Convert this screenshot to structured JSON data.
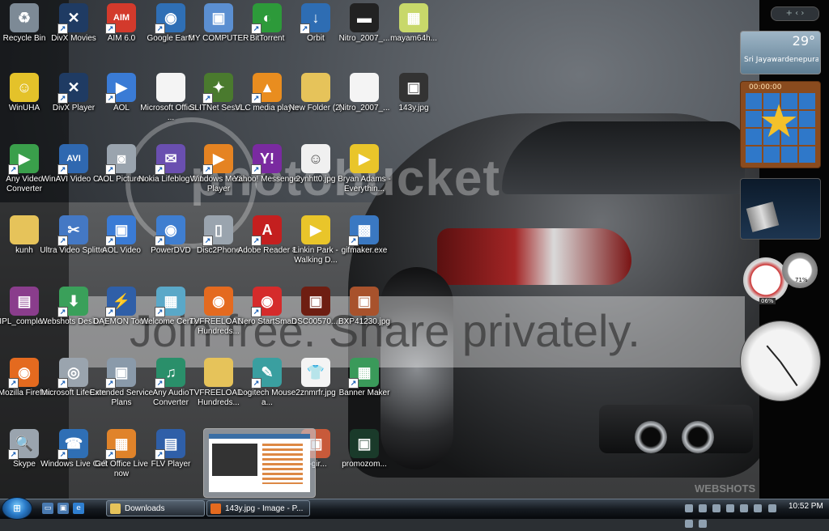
{
  "desktop": {
    "icons": [
      {
        "label": "Recycle Bin",
        "icon": "recycle-bin-icon",
        "color": "#7d8a96",
        "glyph": "♻",
        "shortcut": false
      },
      {
        "label": "DivX Movies",
        "icon": "divx-icon",
        "color": "#1f3b63",
        "glyph": "✕",
        "shortcut": true
      },
      {
        "label": "AIM 6.0",
        "icon": "aim-icon",
        "color": "#d33a2c",
        "glyph": "AIM",
        "shortcut": true
      },
      {
        "label": "Google Earth",
        "icon": "google-earth-icon",
        "color": "#2f6fb5",
        "glyph": "◉",
        "shortcut": true
      },
      {
        "label": "MY COMPUTER",
        "icon": "computer-icon",
        "color": "#5b8fd1",
        "glyph": "▣",
        "shortcut": false
      },
      {
        "label": "BitTorrent",
        "icon": "bittorrent-icon",
        "color": "#2d9a3a",
        "glyph": "◐",
        "shortcut": true
      },
      {
        "label": "Orbit",
        "icon": "orbit-icon",
        "color": "#2e6db3",
        "glyph": "↓",
        "shortcut": true
      },
      {
        "label": "Nitro_2007_...",
        "icon": "file-icon",
        "color": "#222",
        "glyph": "▬",
        "shortcut": false
      },
      {
        "label": "mayam64h...",
        "icon": "image-file-icon",
        "color": "#c8d86a",
        "glyph": "▦",
        "shortcut": false
      },
      {
        "label": "WinUHA",
        "icon": "winuha-icon",
        "color": "#e4c22a",
        "glyph": "☺",
        "shortcut": false
      },
      {
        "label": "DivX Player",
        "icon": "divx-player-icon",
        "color": "#1f3b63",
        "glyph": "✕",
        "shortcut": true
      },
      {
        "label": "AOL",
        "icon": "aol-icon",
        "color": "#3a7bd5",
        "glyph": "▶",
        "shortcut": true
      },
      {
        "label": "Microsoft Office - ...",
        "icon": "document-icon",
        "color": "#f4f4f4",
        "glyph": "",
        "shortcut": false
      },
      {
        "label": "SLITNet Sessi...",
        "icon": "slitnet-icon",
        "color": "#4a7a2e",
        "glyph": "✦",
        "shortcut": true
      },
      {
        "label": "VLC media player",
        "icon": "vlc-icon",
        "color": "#e98d1f",
        "glyph": "▲",
        "shortcut": true
      },
      {
        "label": "New Folder (2)",
        "icon": "folder-icon",
        "color": "#e6c35a",
        "glyph": "",
        "shortcut": false
      },
      {
        "label": "Nitro_2007_...",
        "icon": "document-icon",
        "color": "#f4f4f4",
        "glyph": "",
        "shortcut": false
      },
      {
        "label": "143y.jpg",
        "icon": "image-file-icon",
        "color": "#333",
        "glyph": "▣",
        "shortcut": false
      },
      {
        "label": "Any Video Converter",
        "icon": "video-converter-icon",
        "color": "#3a9f4b",
        "glyph": "▶",
        "shortcut": true
      },
      {
        "label": "WinAVI Video C...",
        "icon": "winavi-icon",
        "color": "#2f68b0",
        "glyph": "AVI",
        "shortcut": true
      },
      {
        "label": "AOL Pictures",
        "icon": "camera-icon",
        "color": "#9aa4ae",
        "glyph": "◙",
        "shortcut": true
      },
      {
        "label": "Nokia Lifeblog 2.1",
        "icon": "nokia-icon",
        "color": "#6a4fb0",
        "glyph": "✉",
        "shortcut": true
      },
      {
        "label": "Windows Media Player",
        "icon": "media-player-icon",
        "color": "#e58322",
        "glyph": "▶",
        "shortcut": true
      },
      {
        "label": "Yahoo! Messenger",
        "icon": "yahoo-icon",
        "color": "#7a2aa0",
        "glyph": "Y!",
        "shortcut": true
      },
      {
        "label": "2ynhtt0.jpg",
        "icon": "image-file-icon",
        "color": "#f0f0f0",
        "glyph": "☺",
        "shortcut": false
      },
      {
        "label": "Bryan Adams - Everythin...",
        "icon": "media-file-icon",
        "color": "#e9c52a",
        "glyph": "▶",
        "shortcut": false
      },
      {
        "label": "",
        "icon": "",
        "color": "",
        "glyph": "",
        "shortcut": false
      },
      {
        "label": "kunh",
        "icon": "folder-icon",
        "color": "#e6c35a",
        "glyph": "",
        "shortcut": false
      },
      {
        "label": "Ultra Video Splitter",
        "icon": "video-splitter-icon",
        "color": "#4478c4",
        "glyph": "✂",
        "shortcut": true
      },
      {
        "label": "AOL Video",
        "icon": "aol-video-icon",
        "color": "#3a7bd5",
        "glyph": "▣",
        "shortcut": true
      },
      {
        "label": "PowerDVD",
        "icon": "powerdvd-icon",
        "color": "#3f7ed0",
        "glyph": "◉",
        "shortcut": true
      },
      {
        "label": "Disc2Phone",
        "icon": "disc2phone-icon",
        "color": "#9aa4ae",
        "glyph": "▯",
        "shortcut": true
      },
      {
        "label": "Adobe Reader 8",
        "icon": "adobe-reader-icon",
        "color": "#c41f1f",
        "glyph": "A",
        "shortcut": true
      },
      {
        "label": "Linkin Park - Walking D...",
        "icon": "media-file-icon",
        "color": "#e9c52a",
        "glyph": "▶",
        "shortcut": false
      },
      {
        "label": "gifmaker.exe",
        "icon": "gifmaker-icon",
        "color": "#3a78c2",
        "glyph": "▩",
        "shortcut": true
      },
      {
        "label": "",
        "icon": "",
        "color": "",
        "glyph": "",
        "shortcut": false
      },
      {
        "label": "IPL_comple...",
        "icon": "archive-icon",
        "color": "#8a3d8c",
        "glyph": "▤",
        "shortcut": false
      },
      {
        "label": "Webshots Desktop",
        "icon": "webshots-icon",
        "color": "#3aa05a",
        "glyph": "⬇",
        "shortcut": true
      },
      {
        "label": "DAEMON Tools",
        "icon": "daemon-tools-icon",
        "color": "#2f5fa8",
        "glyph": "⚡",
        "shortcut": true
      },
      {
        "label": "Welcome Center",
        "icon": "welcome-center-icon",
        "color": "#5aa8c8",
        "glyph": "▦",
        "shortcut": true
      },
      {
        "label": "TVFREELOAD - Hundreds...",
        "icon": "firefox-doc-icon",
        "color": "#e46a1f",
        "glyph": "◉",
        "shortcut": false
      },
      {
        "label": "Nero StartSmart",
        "icon": "nero-icon",
        "color": "#d52b2b",
        "glyph": "◉",
        "shortcut": true
      },
      {
        "label": "DSC00570....",
        "icon": "image-file-icon",
        "color": "#6e1e12",
        "glyph": "▣",
        "shortcut": false
      },
      {
        "label": "BXP41230.jpg",
        "icon": "image-file-icon",
        "color": "#a8522c",
        "glyph": "▣",
        "shortcut": false
      },
      {
        "label": "",
        "icon": "",
        "color": "",
        "glyph": "",
        "shortcut": false
      },
      {
        "label": "Mozilla Firefox",
        "icon": "firefox-icon",
        "color": "#e46a1f",
        "glyph": "◉",
        "shortcut": true
      },
      {
        "label": "Microsoft LifeCam",
        "icon": "webcam-icon",
        "color": "#9aa4ae",
        "glyph": "◎",
        "shortcut": true
      },
      {
        "label": "Extended Service Plans",
        "icon": "service-plans-icon",
        "color": "#8a9aaa",
        "glyph": "▣",
        "shortcut": true
      },
      {
        "label": "Any Audio Converter",
        "icon": "audio-converter-icon",
        "color": "#2a8f6a",
        "glyph": "♫",
        "shortcut": true
      },
      {
        "label": "TVFREELOAD - Hundreds...",
        "icon": "folder-icon",
        "color": "#e6c35a",
        "glyph": "",
        "shortcut": false
      },
      {
        "label": "Logitech Mouse a...",
        "icon": "logitech-icon",
        "color": "#3a9fa0",
        "glyph": "✎",
        "shortcut": true
      },
      {
        "label": "2znmrfr.jpg",
        "icon": "image-file-icon",
        "color": "#f4f4f4",
        "glyph": "👕",
        "shortcut": false
      },
      {
        "label": "Banner Maker",
        "icon": "banner-maker-icon",
        "color": "#3a9a5a",
        "glyph": "▦",
        "shortcut": true
      },
      {
        "label": "",
        "icon": "",
        "color": "",
        "glyph": "",
        "shortcut": false
      },
      {
        "label": "Skype",
        "icon": "skype-icon",
        "color": "#9aa4ae",
        "glyph": "🔍",
        "shortcut": true
      },
      {
        "label": "Windows Live Call",
        "icon": "live-call-icon",
        "color": "#2f6fb5",
        "glyph": "☎",
        "shortcut": true
      },
      {
        "label": "Get Office Live now",
        "icon": "office-live-icon",
        "color": "#e0832a",
        "glyph": "▦",
        "shortcut": true
      },
      {
        "label": "FLV Player",
        "icon": "flv-player-icon",
        "color": "#2f5fa8",
        "glyph": "▤",
        "shortcut": true
      },
      {
        "label": "",
        "icon": "",
        "color": "",
        "glyph": "",
        "shortcut": false
      },
      {
        "label": "",
        "icon": "",
        "color": "",
        "glyph": "",
        "shortcut": false
      },
      {
        "label": "y-gir...",
        "icon": "image-file-icon",
        "color": "#c85a3a",
        "glyph": "▣",
        "shortcut": false
      },
      {
        "label": "promozom...",
        "icon": "image-file-icon",
        "color": "#1a3a2a",
        "glyph": "▣",
        "shortcut": false
      },
      {
        "label": "",
        "icon": "",
        "color": "",
        "glyph": "",
        "shortcut": false
      }
    ]
  },
  "watermark": {
    "brand": "photobucket",
    "banner": "Join free. Share privately.",
    "webshots": "WEBSHOTS"
  },
  "sidebar": {
    "controls": "+  ‹ ›",
    "weather": {
      "temp": "29°",
      "city": "Sri Jayawardenepura..."
    },
    "puzzle": {
      "time": "00:00:00"
    },
    "meters": {
      "cpu": "06%",
      "mem": "71%"
    }
  },
  "preview": {
    "visible": true
  },
  "taskbar": {
    "start_label": "⊞",
    "quick_launch": [
      {
        "icon": "show-desktop-icon",
        "color": "#4a7ab0",
        "glyph": "▭"
      },
      {
        "icon": "switch-windows-icon",
        "color": "#4a7ab0",
        "glyph": "▣"
      },
      {
        "icon": "internet-explorer-icon",
        "color": "#2f7fd0",
        "glyph": "e"
      }
    ],
    "tasks": [
      {
        "label": "Downloads",
        "icon_color": "#e6c35a",
        "active": false
      },
      {
        "label": "143y.jpg - Image - P...",
        "icon_color": "#e46a1f",
        "active": true
      }
    ],
    "time": "10:52 PM"
  }
}
